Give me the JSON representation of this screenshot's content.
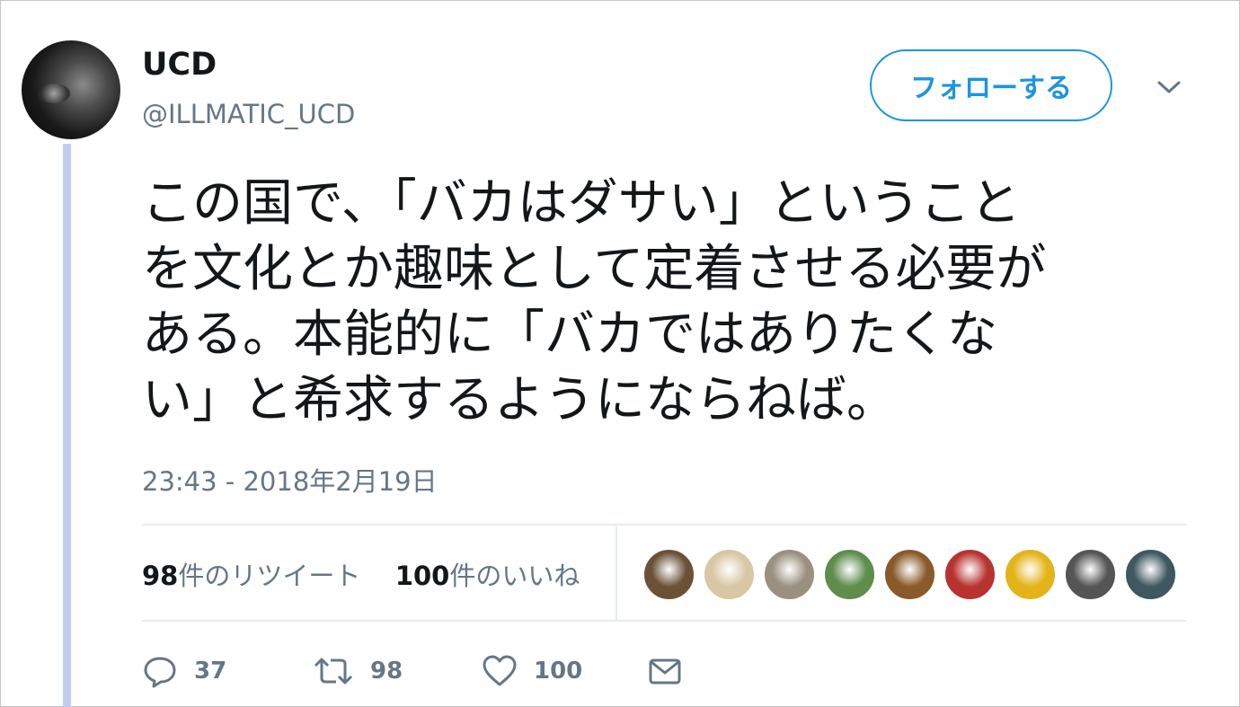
{
  "user": {
    "display_name": "UCD",
    "handle": "@ILLMATIC_UCD"
  },
  "follow_button": {
    "label": "フォローする"
  },
  "tweet": {
    "lines": [
      "この国で、「バカはダサい」ということ",
      "を文化とか趣味として定着させる必要が",
      "ある。本能的に「バカではありたくな",
      "い」と希求するようにならねば。"
    ],
    "timestamp": "23:43 - 2018年2月19日"
  },
  "stats": {
    "retweet_count": "98",
    "retweet_label": "件のリツイート",
    "like_count": "100",
    "like_label": "件のいいね"
  },
  "likers": [
    {
      "icon": "liker-avatar-deer",
      "color": "#6b5237"
    },
    {
      "icon": "liker-avatar-food",
      "color": "#d8c7a4"
    },
    {
      "icon": "liker-avatar-cat",
      "color": "#9a9080"
    },
    {
      "icon": "liker-avatar-landscape",
      "color": "#5e8d4c"
    },
    {
      "icon": "liker-avatar-character",
      "color": "#8a5a2b"
    },
    {
      "icon": "liker-avatar-red-hat",
      "color": "#b8332f"
    },
    {
      "icon": "liker-avatar-yellow-face",
      "color": "#e3b319"
    },
    {
      "icon": "liker-avatar-bw-photo",
      "color": "#555555"
    },
    {
      "icon": "liker-avatar-train",
      "color": "#3f5860"
    }
  ],
  "actions": {
    "reply_count": "37",
    "retweet_count": "98",
    "like_count": "100"
  },
  "colors": {
    "accent": "#1b95e0",
    "secondary_text": "#657786",
    "thread_line": "#c4cbf2"
  }
}
